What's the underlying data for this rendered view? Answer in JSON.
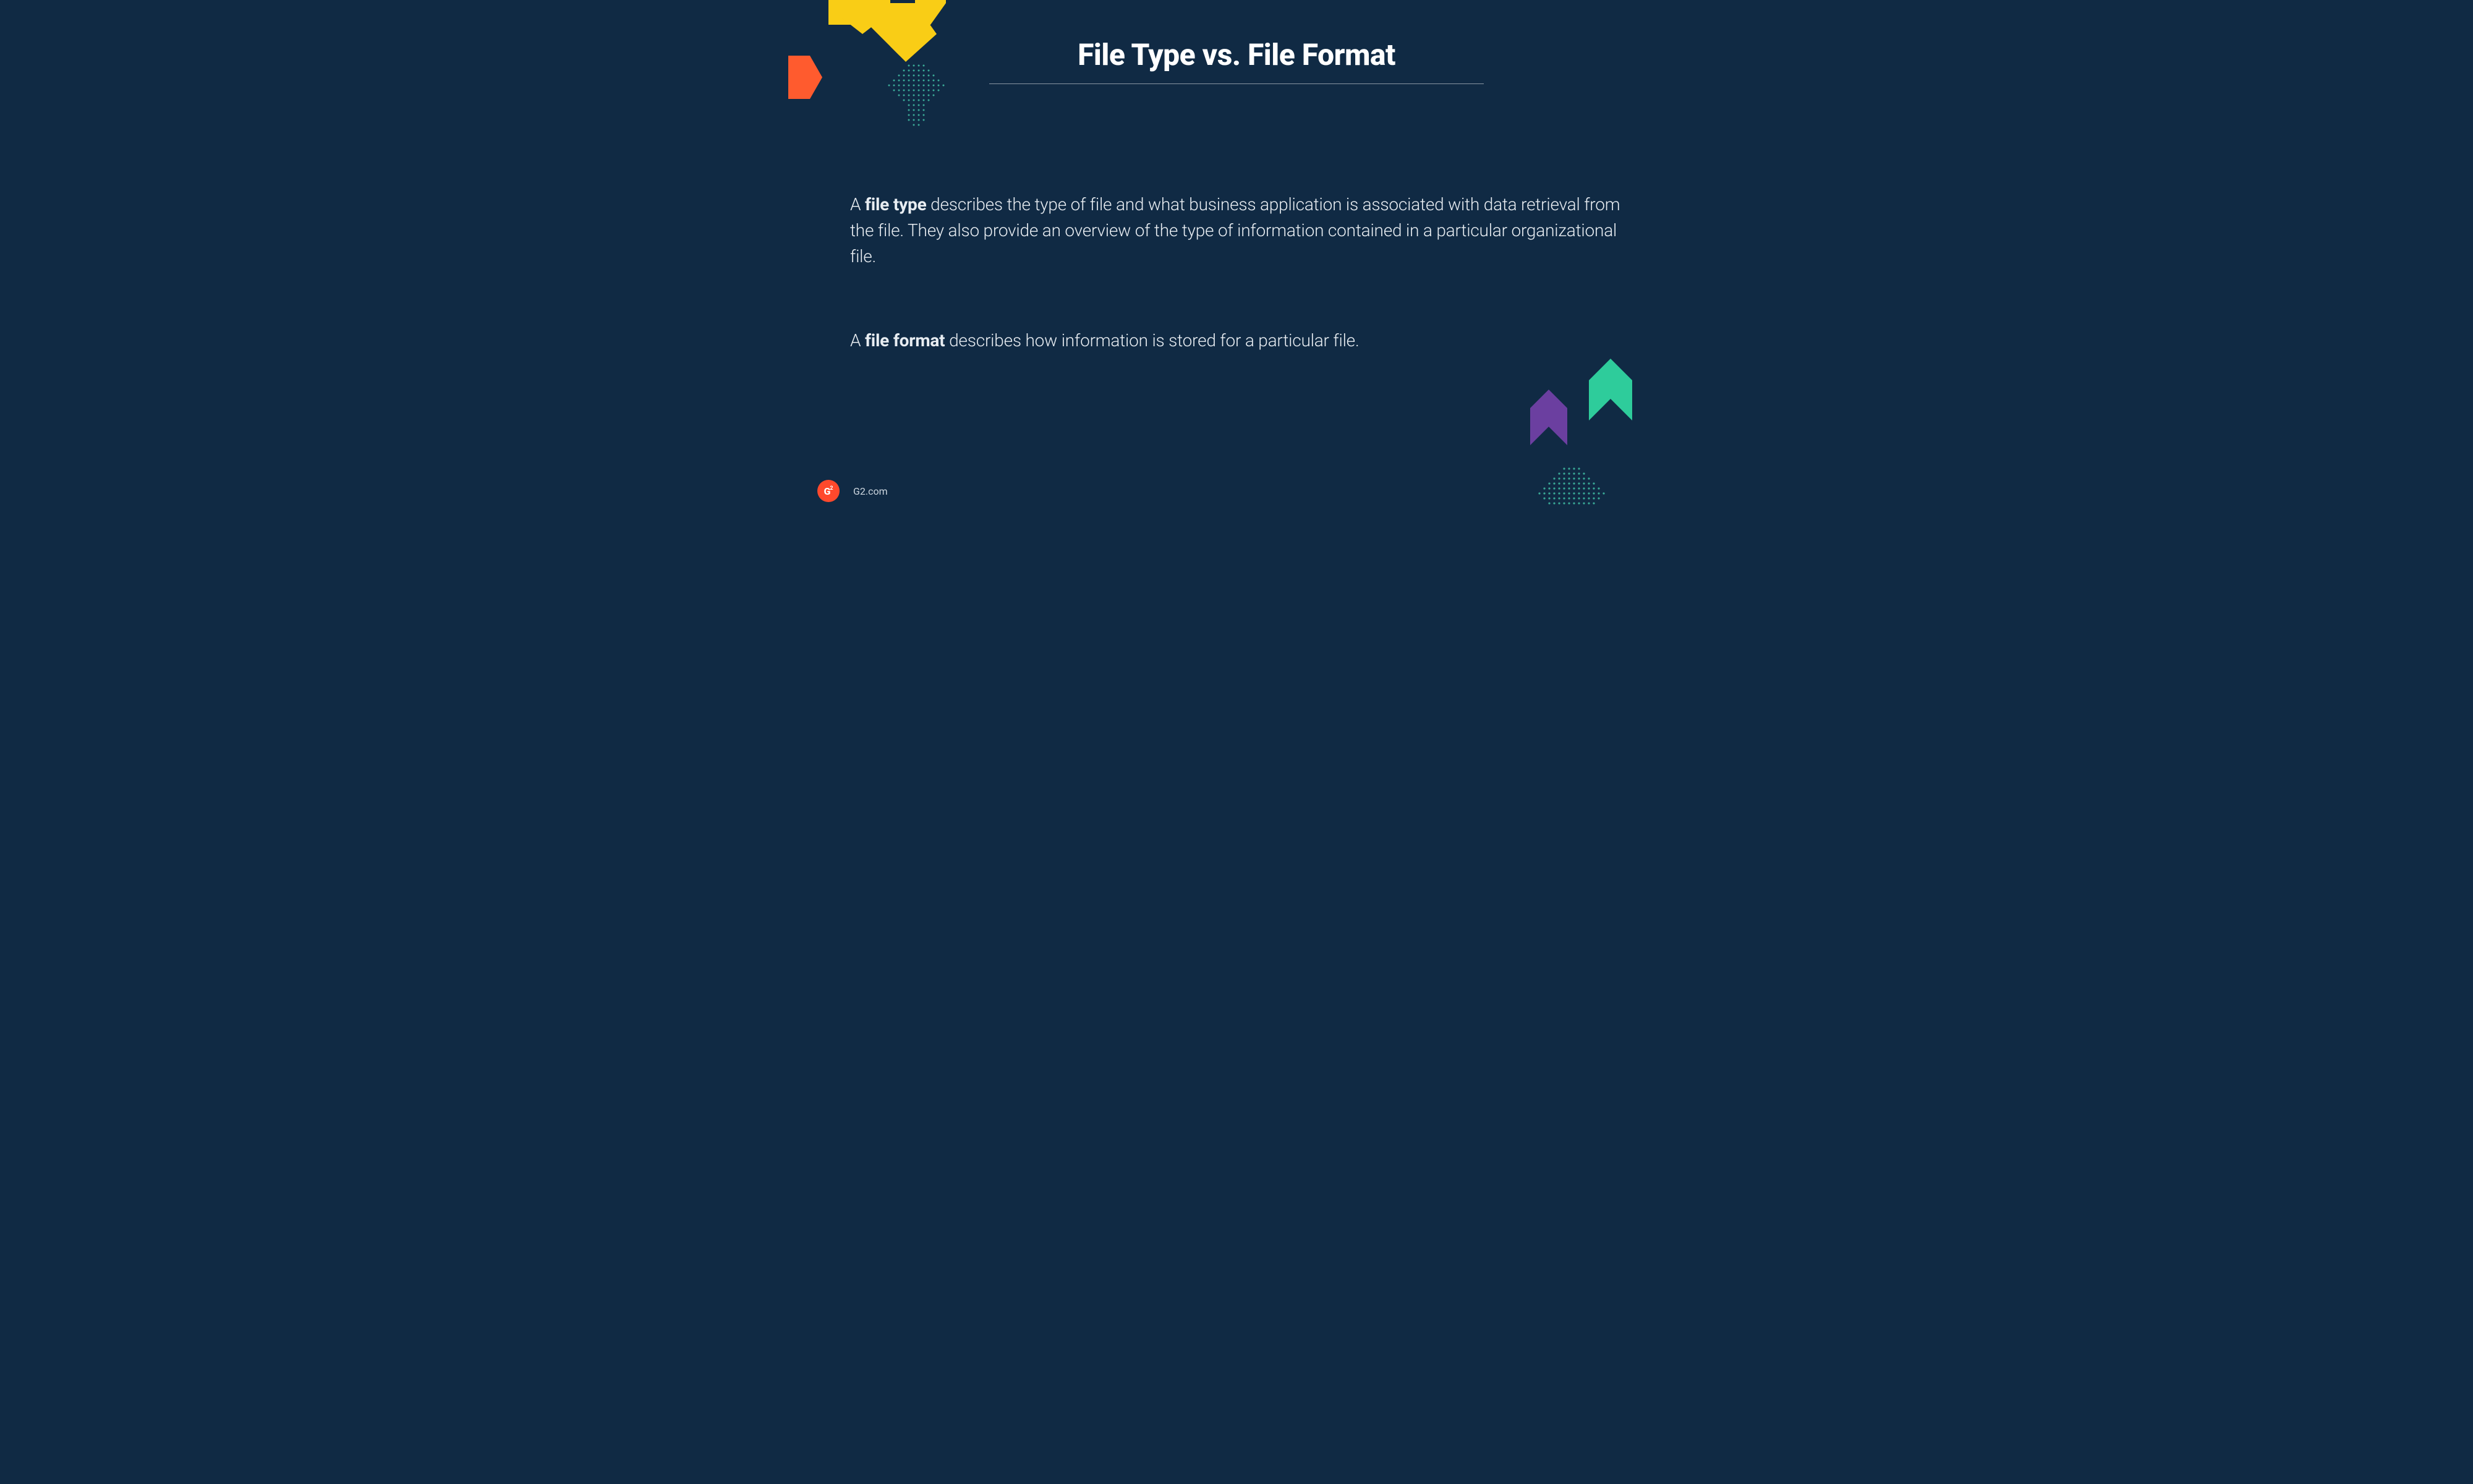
{
  "title": "File Type vs. File Format",
  "paragraph1": {
    "prefix": "A ",
    "bold": "file type",
    "suffix": " describes the type of file and what business application is associated with data retrieval from the  file. They also provide an overview of the type of information contained in a particular organizational file."
  },
  "paragraph2": {
    "prefix": "A ",
    "bold": "file format",
    "suffix": " describes how information is stored for a particular file."
  },
  "footer": {
    "logo_text": "G",
    "logo_sup": "2",
    "site": "G2.com"
  },
  "colors": {
    "background": "#102a44",
    "yellow": "#f9cd16",
    "orange": "#ff5b2e",
    "purple": "#6b3fa0",
    "green": "#2ecc9b",
    "teal_dot": "#3aa896"
  }
}
